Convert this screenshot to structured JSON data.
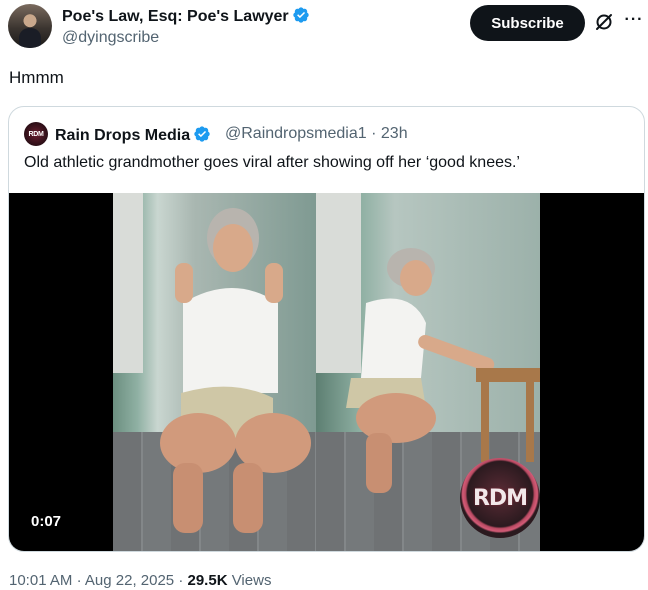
{
  "author": {
    "name": "Poe's Law, Esq: Poe's Lawyer",
    "handle": "@dyingscribe"
  },
  "actions": {
    "subscribe_label": "Subscribe",
    "grok_icon": "grok-slash-icon",
    "more_icon": "more-horizontal-icon",
    "more_glyph": "···"
  },
  "tweet": {
    "text": "Hmmm"
  },
  "quote": {
    "avatar_text": "RDM",
    "name": "Rain Drops Media",
    "handle": "@Raindropsmedia1",
    "separator": "·",
    "time": "23h",
    "text": "Old athletic grandmother goes viral after showing off her ‘good knees.’",
    "video": {
      "duration": "0:07",
      "watermark": "RDM"
    }
  },
  "footer": {
    "time": "10:01 AM",
    "date": "Aug 22, 2025",
    "views_count": "29.5K",
    "views_label": "Views",
    "separator": "·"
  },
  "colors": {
    "verified_blue": "#1d9bf0",
    "text_primary": "#0f1419",
    "text_secondary": "#536471",
    "border": "#cfd9de"
  }
}
